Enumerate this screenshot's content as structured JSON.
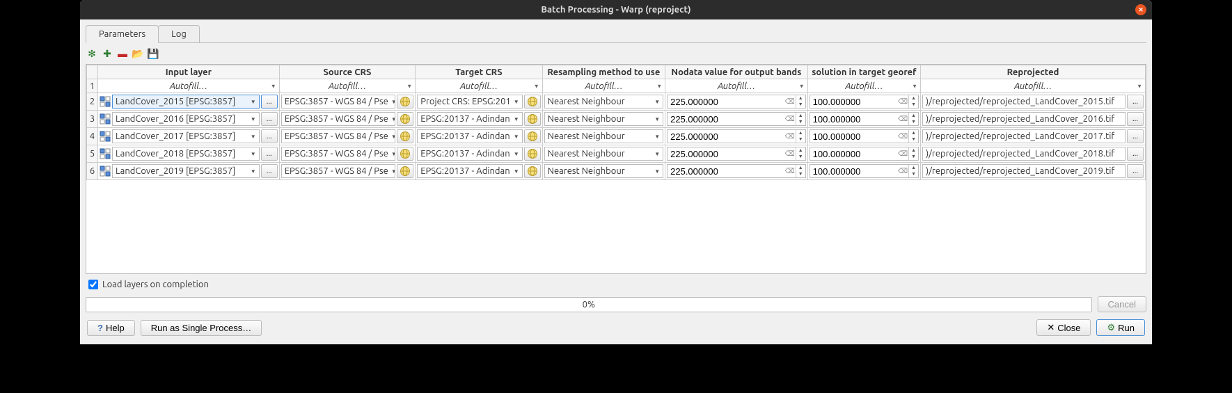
{
  "title": "Batch Processing - Warp (reproject)",
  "tabs": {
    "parameters": "Parameters",
    "log": "Log"
  },
  "columns": {
    "input": "Input layer",
    "source": "Source CRS",
    "target": "Target CRS",
    "resampling": "Resampling method to use",
    "nodata": "Nodata value for output bands",
    "resolution": "solution in target georef",
    "reprojected": "Reprojected"
  },
  "autofill": "Autofill…",
  "ellipsis": "...",
  "rows": [
    {
      "num": "2",
      "input": "LandCover_2015 [EPSG:3857]",
      "source": "EPSG:3857 - WGS 84 / Pse",
      "target": "Project CRS: EPSG:201",
      "resampling": "Nearest Neighbour",
      "nodata": "225.000000",
      "resolution": "100.000000",
      "reprojected": ")/reprojected/reprojected_LandCover_2015.tif",
      "selected": true
    },
    {
      "num": "3",
      "input": "LandCover_2016 [EPSG:3857]",
      "source": "EPSG:3857 - WGS 84 / Pse",
      "target": "EPSG:20137 - Adindan",
      "resampling": "Nearest Neighbour",
      "nodata": "225.000000",
      "resolution": "100.000000",
      "reprojected": ")/reprojected/reprojected_LandCover_2016.tif",
      "selected": false
    },
    {
      "num": "4",
      "input": "LandCover_2017 [EPSG:3857]",
      "source": "EPSG:3857 - WGS 84 / Pse",
      "target": "EPSG:20137 - Adindan",
      "resampling": "Nearest Neighbour",
      "nodata": "225.000000",
      "resolution": "100.000000",
      "reprojected": ")/reprojected/reprojected_LandCover_2017.tif",
      "selected": false
    },
    {
      "num": "5",
      "input": "LandCover_2018 [EPSG:3857]",
      "source": "EPSG:3857 - WGS 84 / Pse",
      "target": "EPSG:20137 - Adindan",
      "resampling": "Nearest Neighbour",
      "nodata": "225.000000",
      "resolution": "100.000000",
      "reprojected": ")/reprojected/reprojected_LandCover_2018.tif",
      "selected": false
    },
    {
      "num": "6",
      "input": "LandCover_2019 [EPSG:3857]",
      "source": "EPSG:3857 - WGS 84 / Pse",
      "target": "EPSG:20137 - Adindan",
      "resampling": "Nearest Neighbour",
      "nodata": "225.000000",
      "resolution": "100.000000",
      "reprojected": ")/reprojected/reprojected_LandCover_2019.tif",
      "selected": false
    }
  ],
  "load_layers": "Load layers on completion",
  "load_checked": true,
  "progress": "0%",
  "buttons": {
    "cancel": "Cancel",
    "help": "Help",
    "single": "Run as Single Process…",
    "close": "Close",
    "run": "Run"
  },
  "first_row_num": "1"
}
